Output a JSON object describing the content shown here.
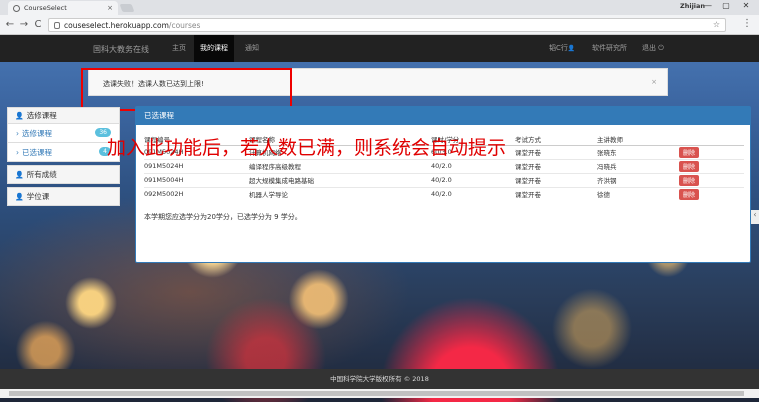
{
  "browser": {
    "tab_title": "CourseSelect",
    "tab_close": "×",
    "user_badge": "Zhijian",
    "url_host": "couseselect.herokuapp.com",
    "url_path": "/courses",
    "back": "←",
    "forward": "→",
    "reload": "C",
    "star": "☆",
    "menu": "⋮",
    "minimize": "—",
    "maximize": "▢",
    "close": "✕"
  },
  "nav": {
    "brand": "国科大教务在线",
    "items": [
      {
        "label": "主页"
      },
      {
        "label": "我的课程"
      },
      {
        "label": "通知"
      }
    ],
    "user": "韬C行",
    "user_icon": "👤",
    "software": "软件研究所",
    "logout": "退出",
    "logout_icon": "⏻"
  },
  "alert": {
    "message": "选课失败！选课人数已达到上限!",
    "close": "×"
  },
  "annotation": "加入此功能后，若人数已满，则系统会自动提示",
  "sidebar": {
    "heading": "选修课程",
    "items": [
      {
        "label": "选修课程",
        "badge": "36"
      },
      {
        "label": "已选课程",
        "badge": "4"
      }
    ],
    "groups": [
      {
        "label": "所有成绩"
      },
      {
        "label": "学位课"
      }
    ]
  },
  "panel": {
    "title": "已选课程",
    "columns": [
      "课程编号",
      "课程名称",
      "课时/学分",
      "考试方式",
      "主讲教师",
      ""
    ],
    "rows": [
      {
        "id": "091M5024H",
        "name": "计算机网络",
        "credit": "60/3.0",
        "exam": "课堂开卷",
        "teacher": "张晓东",
        "action": "删除"
      },
      {
        "id": "091M5024H",
        "name": "编译程序高级教程",
        "credit": "40/2.0",
        "exam": "课堂开卷",
        "teacher": "冯晓兵",
        "action": "删除"
      },
      {
        "id": "091M5004H",
        "name": "超大规模集成电路基础",
        "credit": "40/2.0",
        "exam": "课堂开卷",
        "teacher": "齐洪钢",
        "action": "删除"
      },
      {
        "id": "092M5002H",
        "name": "机器人学导论",
        "credit": "40/2.0",
        "exam": "课堂开卷",
        "teacher": "徐德",
        "action": "删除"
      }
    ],
    "summary": "本学期您应选学分为20学分，已选学分为 9 学分。"
  },
  "footer": "中国科学院大学版权所有 © 2018",
  "colors": {
    "navbar": "#222222",
    "panel_header": "#337ab7",
    "delete_button": "#d9534f",
    "highlight": "#ee0000"
  }
}
